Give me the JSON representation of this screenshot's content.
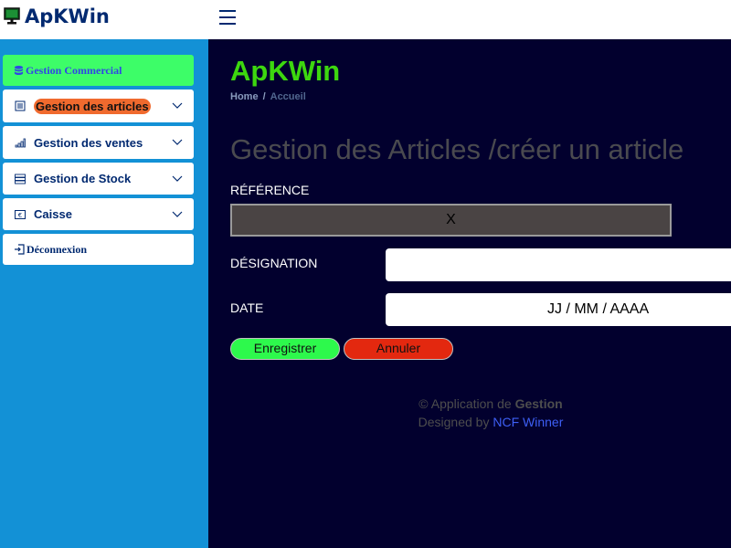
{
  "header": {
    "brand": "ApKWin",
    "logo_icon": "monitor-logo-icon",
    "menu_icon": "hamburger-icon"
  },
  "sidebar": {
    "items": [
      {
        "label": "Gestion Commercial",
        "icon": "database-icon"
      },
      {
        "label": "Gestion des articles",
        "icon": "list-icon"
      },
      {
        "label": "Gestion des ventes",
        "icon": "bar-chart-icon"
      },
      {
        "label": "Gestion de Stock",
        "icon": "stock-icon"
      },
      {
        "label": "Caisse",
        "icon": "cash-icon"
      },
      {
        "label": "Déconnexion",
        "icon": "logout-icon"
      }
    ]
  },
  "main": {
    "title": "ApKWin",
    "breadcrumb": {
      "home": "Home",
      "separator": "/",
      "current": "Accueil"
    },
    "section_title": "Gestion des Articles /créer un article",
    "form": {
      "reference_label": "RÉFÉRENCE",
      "reference_value": "X",
      "designation_label": "DÉSIGNATION",
      "designation_value": "",
      "date_label": "DATE",
      "date_placeholder": "JJ / MM / AAAA"
    },
    "buttons": {
      "save": "Enregistrer",
      "cancel": "Annuler"
    },
    "footer": {
      "copyright_prefix": "© Application de ",
      "copyright_bold": "Gestion",
      "designed_prefix": "Designed by ",
      "designed_link": "NCF Winner"
    }
  },
  "colors": {
    "header_bg": "#ffffff",
    "sidebar_bg": "#1391d6",
    "main_bg": "#02002e",
    "title_green": "#3dd70f",
    "save_green": "#2df94c",
    "cancel_red": "#e3280f",
    "highlight_orange": "#f06a2e",
    "nav_text": "#012970"
  }
}
